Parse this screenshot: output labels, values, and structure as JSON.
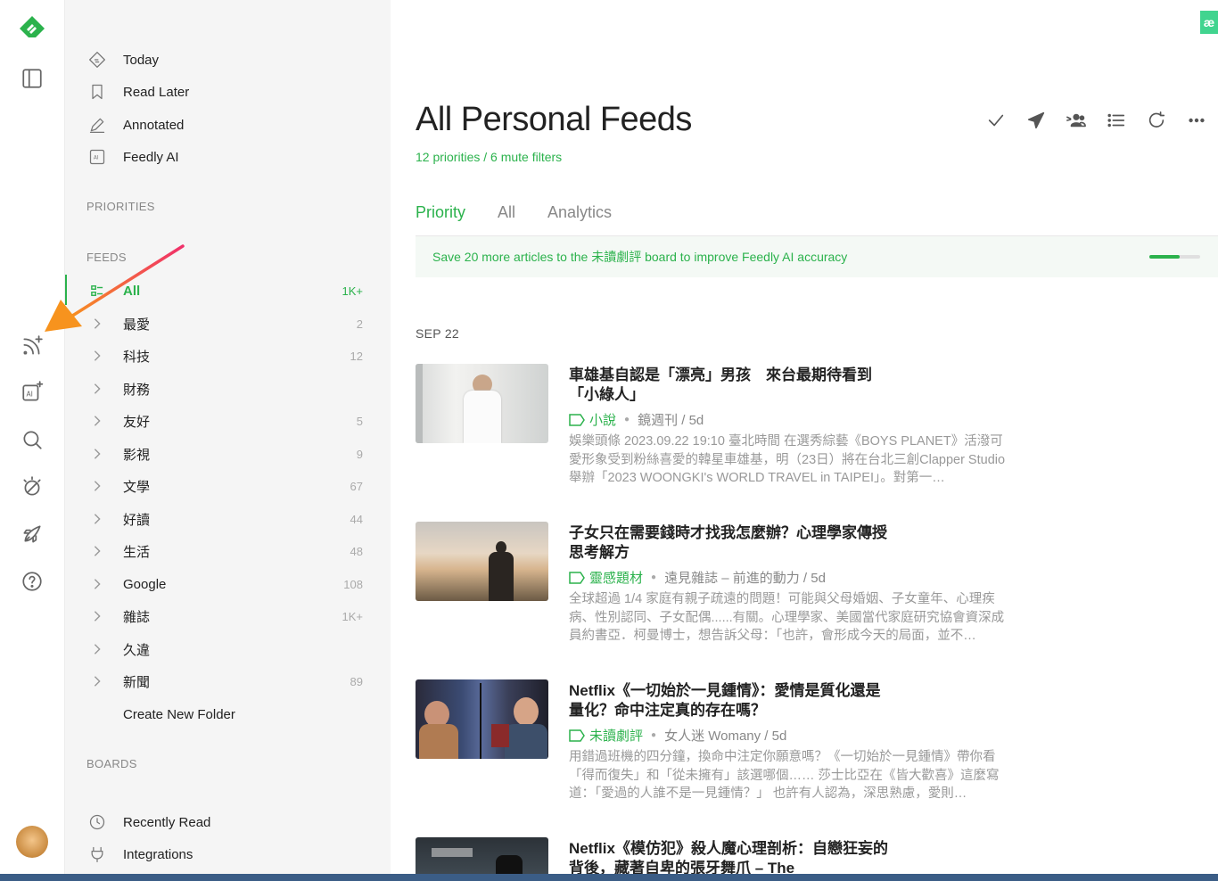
{
  "sidebar": {
    "nav": [
      {
        "label": "Today",
        "icon": "today-icon"
      },
      {
        "label": "Read Later",
        "icon": "bookmark-icon"
      },
      {
        "label": "Annotated",
        "icon": "pencil-icon"
      },
      {
        "label": "Feedly AI",
        "icon": "ai-box-icon"
      }
    ],
    "priorities_header": "PRIORITIES",
    "feeds_header": "FEEDS",
    "feeds": [
      {
        "label": "All",
        "count": "1K+"
      },
      {
        "label": "最愛",
        "count": "2"
      },
      {
        "label": "科技",
        "count": "12"
      },
      {
        "label": "財務",
        "count": ""
      },
      {
        "label": "友好",
        "count": "5"
      },
      {
        "label": "影視",
        "count": "9"
      },
      {
        "label": "文學",
        "count": "67"
      },
      {
        "label": "好讀",
        "count": "44"
      },
      {
        "label": "生活",
        "count": "48"
      },
      {
        "label": "Google",
        "count": "108"
      },
      {
        "label": "雜誌",
        "count": "1K+"
      },
      {
        "label": "久違",
        "count": ""
      },
      {
        "label": "新聞",
        "count": "89"
      }
    ],
    "create_folder": "Create New Folder",
    "boards_header": "BOARDS",
    "boards": [
      {
        "label": "Recently Read",
        "icon": "clock-icon"
      },
      {
        "label": "Integrations",
        "icon": "plug-icon"
      }
    ]
  },
  "main": {
    "title": "All Personal Feeds",
    "subtitle": "12 priorities / 6 mute filters",
    "tabs": [
      "Priority",
      "All",
      "Analytics"
    ],
    "banner": "Save 20 more articles to the 未讀劇評 board to improve Feedly AI accuracy",
    "progress": 0.6,
    "date_header": "SEP 22",
    "articles": [
      {
        "title": "車雄基自認是「漂亮」男孩　來台最期待看到「小綠人」",
        "tag": "小說",
        "source": "鏡週刊 / 5d",
        "summary": "娛樂頭條 2023.09.22 19:10 臺北時間 在選秀綜藝《BOYS PLANET》活潑可愛形象受到粉絲喜愛的韓星車雄基，明（23日）將在台北三創Clapper Studio舉辦「2023 WOONGKI's WORLD TRAVEL in TAIPEI」。對第一…"
      },
      {
        "title": "子女只在需要錢時才找我怎麼辦？心理學家傳授思考解方",
        "tag": "靈感題材",
        "source": "遠見雜誌 – 前進的動力 / 5d",
        "summary": "全球超過 1/4 家庭有親子疏遠的問題！可能與父母婚姻、子女童年、心理疾病、性別認同、子女配偶......有關。心理學家、美國當代家庭研究協會資深成員約書亞．柯曼博士，想告訴父母：「也許，會形成今天的局面，並不…"
      },
      {
        "title": "Netflix《一切始於一見鍾情》：愛情是質化還是量化？命中注定真的存在嗎？",
        "tag": "未讀劇評",
        "source": "女人迷 Womany / 5d",
        "summary": "用錯過班機的四分鐘，換命中注定你願意嗎？《一切始於一見鍾情》帶你看「得而復失」和「從未擁有」該選哪個…… 莎士比亞在《皆大歡喜》這麼寫道：「愛過的人誰不是一見鍾情？」 也許有人認為，深思熟慮，愛則…"
      },
      {
        "title": "Netflix《模仿犯》殺人魔心理剖析：自戀狂妄的背後，藏著自卑的張牙舞爪 – The",
        "tag": "",
        "source": "",
        "summary": ""
      }
    ]
  },
  "top_badge": "æ",
  "colors": {
    "accent": "#2bb24c"
  }
}
